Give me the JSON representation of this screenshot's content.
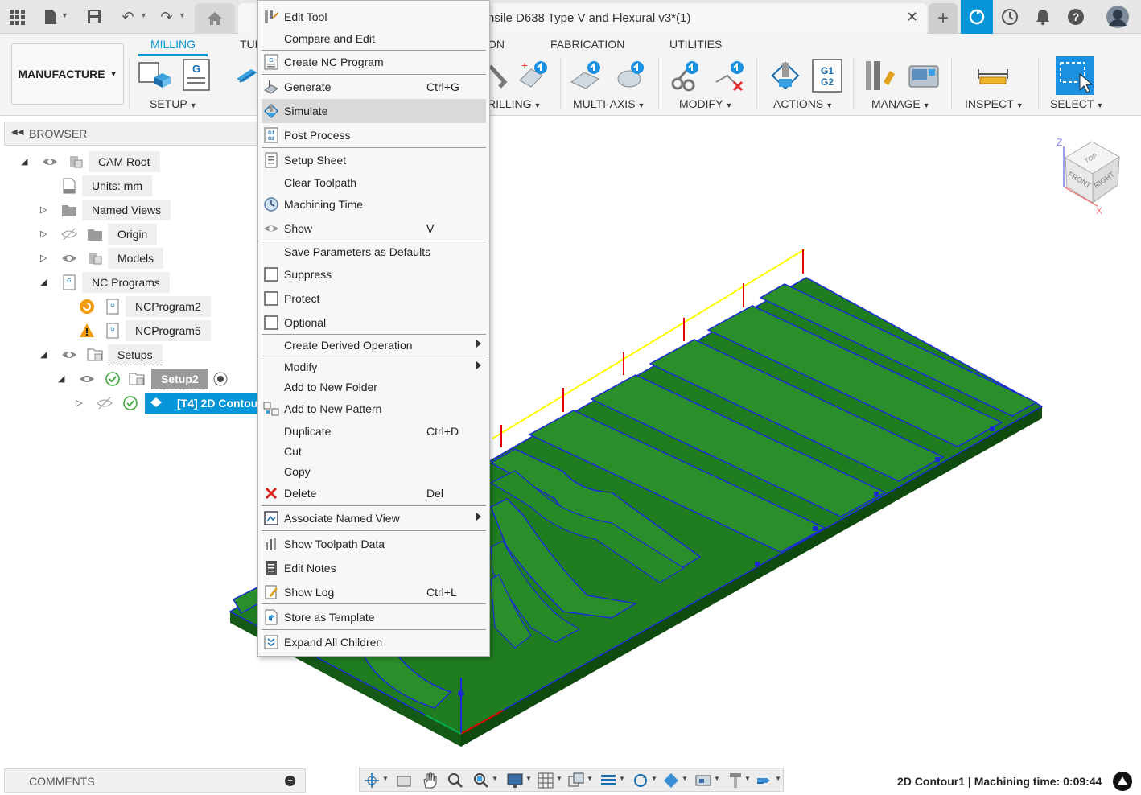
{
  "document": {
    "title": "nsile D638 Type V and Flexural v3*(1)"
  },
  "ribbon": {
    "workspace": "MANUFACTURE",
    "tabs": [
      "MILLING",
      "TUR",
      "ON",
      "FABRICATION",
      "UTILITIES"
    ],
    "groups": [
      "SETUP",
      "RILLING",
      "MULTI-AXIS",
      "MODIFY",
      "ACTIONS",
      "MANAGE",
      "INSPECT",
      "SELECT"
    ]
  },
  "browser": {
    "title": "BROWSER",
    "nodes": {
      "cam_root": "CAM Root",
      "units": "Units: mm",
      "named_views": "Named Views",
      "origin": "Origin",
      "models": "Models",
      "nc_programs": "NC Programs",
      "ncprogram2": "NCProgram2",
      "ncprogram5": "NCProgram5",
      "setups": "Setups",
      "setup2": "Setup2",
      "op": "[T4] 2D Contou"
    }
  },
  "context_menu": {
    "items": [
      {
        "label": "Edit Tool",
        "icon": "edit-tool-icon"
      },
      {
        "label": "Compare and Edit"
      },
      {
        "label": "Create NC Program",
        "icon": "nc-program-icon"
      },
      {
        "label": "Generate",
        "shortcut": "Ctrl+G",
        "icon": "generate-icon"
      },
      {
        "label": "Simulate",
        "icon": "simulate-icon",
        "highlighted": true
      },
      {
        "label": "Post Process",
        "icon": "post-process-icon"
      },
      {
        "label": "Setup Sheet",
        "icon": "setup-sheet-icon"
      },
      {
        "label": "Clear Toolpath"
      },
      {
        "label": "Machining Time",
        "icon": "clock-icon"
      },
      {
        "label": "Show",
        "shortcut": "V",
        "icon": "eye-icon"
      },
      {
        "label": "Save Parameters as Defaults"
      },
      {
        "label": "Suppress",
        "icon": "checkbox-icon"
      },
      {
        "label": "Protect",
        "icon": "checkbox-icon"
      },
      {
        "label": "Optional",
        "icon": "checkbox-icon"
      },
      {
        "label": "Create Derived Operation",
        "submenu": true
      },
      {
        "label": "Modify",
        "submenu": true
      },
      {
        "label": "Add to New Folder"
      },
      {
        "label": "Add to New Pattern",
        "icon": "pattern-icon"
      },
      {
        "label": "Duplicate",
        "shortcut": "Ctrl+D"
      },
      {
        "label": "Cut"
      },
      {
        "label": "Copy"
      },
      {
        "label": "Delete",
        "shortcut": "Del",
        "icon": "delete-x-icon"
      },
      {
        "label": "Associate Named View",
        "submenu": true,
        "icon": "named-view-icon"
      },
      {
        "label": "Show Toolpath Data",
        "icon": "toolpath-data-icon"
      },
      {
        "label": "Edit Notes",
        "icon": "notes-icon"
      },
      {
        "label": "Show Log",
        "shortcut": "Ctrl+L",
        "icon": "log-icon"
      },
      {
        "label": "Store as Template",
        "icon": "template-icon"
      },
      {
        "label": "Expand All Children",
        "icon": "expand-icon"
      }
    ]
  },
  "viewcube": {
    "top": "TOP",
    "front": "FRONT",
    "right": "RIGHT",
    "axis_z": "Z",
    "axis_x": "X"
  },
  "comments": {
    "title": "COMMENTS"
  },
  "status": {
    "text": "2D Contour1 | Machining time: 0:09:44"
  },
  "colors": {
    "accent": "#0696d7",
    "part_green": "#1e7a1e",
    "toolpath_blue": "#1a2bd6",
    "rapid_yellow": "#ffff00",
    "plunge_red": "#e00000"
  }
}
